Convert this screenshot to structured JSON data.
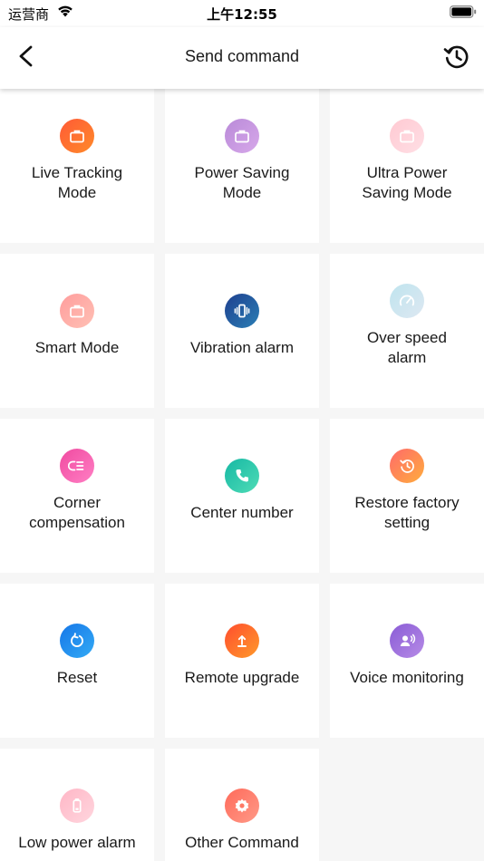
{
  "status_bar": {
    "carrier": "运营商",
    "time": "上午12:55"
  },
  "nav": {
    "title": "Send command"
  },
  "commands": [
    {
      "label_lines": [
        "Live Tracking",
        "Mode"
      ],
      "icon": "briefcase-icon",
      "color_start": "#ff5a36",
      "color_end": "#ff8a2a"
    },
    {
      "label_lines": [
        "Power Saving",
        "Mode"
      ],
      "icon": "briefcase-icon",
      "color_start": "#b98ad8",
      "color_end": "#d7a8ea"
    },
    {
      "label_lines": [
        "Ultra Power",
        "Saving Mode"
      ],
      "icon": "briefcase-icon",
      "color_start": "#ffc9d2",
      "color_end": "#ffdfe5"
    },
    {
      "label_lines": [
        "Smart Mode"
      ],
      "icon": "briefcase-icon",
      "color_start": "#ff9d9d",
      "color_end": "#ffc0b4"
    },
    {
      "label_lines": [
        "Vibration alarm"
      ],
      "icon": "vibration-icon",
      "color_start": "#1e3f8f",
      "color_end": "#2b7fb5"
    },
    {
      "label_lines": [
        "Over speed",
        "alarm"
      ],
      "icon": "speedometer-icon",
      "color_start": "#bfe4ee",
      "color_end": "#dde8f2"
    },
    {
      "label_lines": [
        "Corner",
        "compensation"
      ],
      "icon": "corner-list-icon",
      "color_start": "#f04aa0",
      "color_end": "#ff7fc4"
    },
    {
      "label_lines": [
        "Center number"
      ],
      "icon": "phone-icon",
      "color_start": "#16b8a4",
      "color_end": "#4fdcb6"
    },
    {
      "label_lines": [
        "Restore factory",
        "setting"
      ],
      "icon": "restore-icon",
      "color_start": "#ff6a6a",
      "color_end": "#ffad3d"
    },
    {
      "label_lines": [
        "Reset"
      ],
      "icon": "reset-icon",
      "color_start": "#1677e8",
      "color_end": "#33aaf5"
    },
    {
      "label_lines": [
        "Remote upgrade"
      ],
      "icon": "upload-icon",
      "color_start": "#ff4d2e",
      "color_end": "#ff9a2a"
    },
    {
      "label_lines": [
        "Voice monitoring"
      ],
      "icon": "voice-icon",
      "color_start": "#8a5cd6",
      "color_end": "#b68be6"
    },
    {
      "label_lines": [
        "Low power alarm"
      ],
      "icon": "battery-low-icon",
      "color_start": "#ffb6c6",
      "color_end": "#ffd6de"
    },
    {
      "label_lines": [
        "Other Command"
      ],
      "icon": "gear-icon",
      "color_start": "#ff6a5a",
      "color_end": "#ff9a88"
    }
  ]
}
